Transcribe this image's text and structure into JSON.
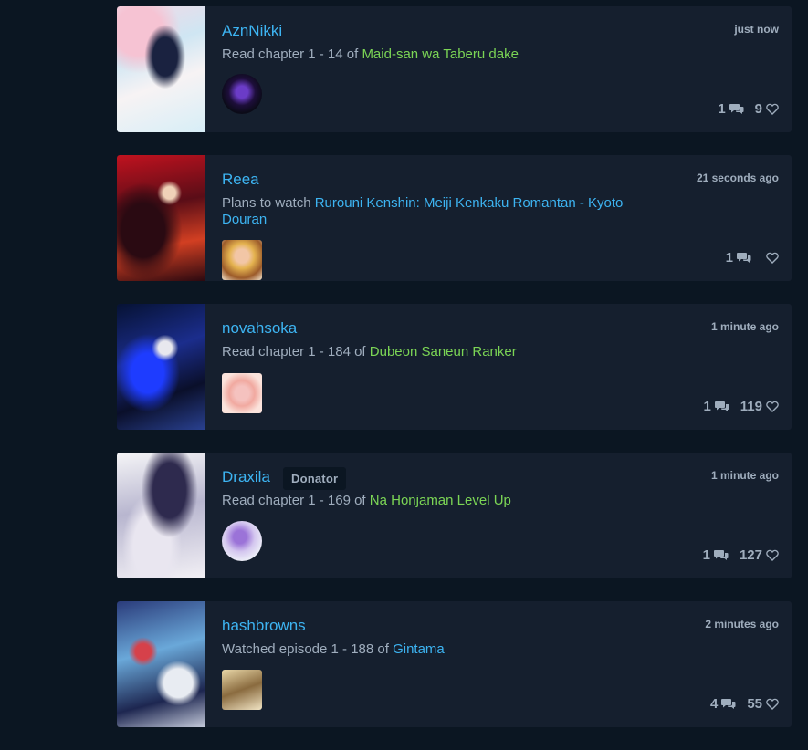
{
  "feed": [
    {
      "user": "AznNikki",
      "badge": "",
      "time": "just now",
      "action": "Read chapter 1 - 14 of ",
      "media": "Maid-san wa Taberu dake",
      "media_color": "green",
      "replies": "1",
      "likes": "9",
      "cover_icon": "manga-cover",
      "avatar_icon": "user-avatar"
    },
    {
      "user": "Reea",
      "badge": "",
      "time": "21 seconds ago",
      "action": "Plans to watch ",
      "media": "Rurouni Kenshin: Meiji Kenkaku Romantan - Kyoto Douran",
      "media_color": "blue",
      "replies": "1",
      "likes": "",
      "cover_icon": "anime-cover",
      "avatar_icon": "user-avatar"
    },
    {
      "user": "novahsoka",
      "badge": "",
      "time": "1 minute ago",
      "action": "Read chapter 1 - 184 of ",
      "media": "Dubeon Saneun Ranker",
      "media_color": "green",
      "replies": "1",
      "likes": "119",
      "cover_icon": "manga-cover",
      "avatar_icon": "user-avatar"
    },
    {
      "user": "Draxila",
      "badge": "Donator",
      "time": "1 minute ago",
      "action": "Read chapter 1 - 169 of ",
      "media": "Na Honjaman Level Up",
      "media_color": "green",
      "replies": "1",
      "likes": "127",
      "cover_icon": "manga-cover",
      "avatar_icon": "user-avatar"
    },
    {
      "user": "hashbrowns",
      "badge": "",
      "time": "2 minutes ago",
      "action": "Watched episode 1 - 188 of ",
      "media": "Gintama",
      "media_color": "blue",
      "replies": "4",
      "likes": "55",
      "cover_icon": "anime-cover",
      "avatar_icon": "user-avatar"
    }
  ],
  "colors": {
    "background": "#0b1622",
    "card": "#151f2e",
    "link_blue": "#3db4f2",
    "manga_green": "#7bd555",
    "muted": "#9fadbd"
  },
  "icons": {
    "reply": "comments-icon",
    "like": "heart-icon"
  }
}
